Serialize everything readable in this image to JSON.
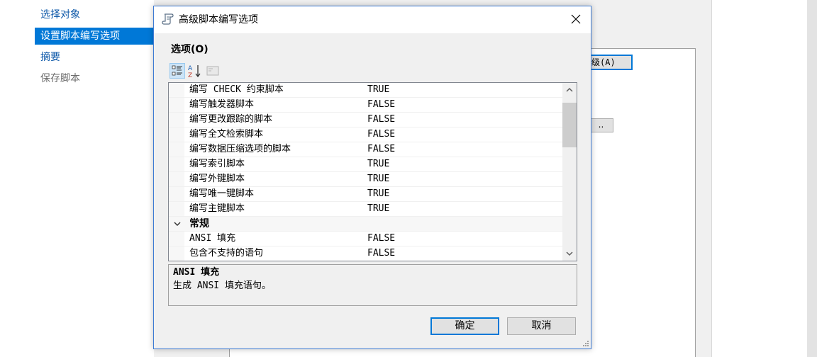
{
  "background": {
    "nav": [
      {
        "label": "选择对象",
        "state": "normal"
      },
      {
        "label": "设置脚本编写选项",
        "state": "active"
      },
      {
        "label": "摘要",
        "state": "normal"
      },
      {
        "label": "保存脚本",
        "state": "disabled"
      }
    ],
    "advanced_button_partial": "级(A)",
    "dots_button_partial": ".."
  },
  "dialog": {
    "title": "高级脚本编写选项",
    "section_label": "选项(O)",
    "toolbar": {
      "categorized_icon": "categorized-icon",
      "alphabetical_icon": "sort-az-icon",
      "property_pages_icon": "property-pages-icon"
    },
    "rows": [
      {
        "name": "编写 CHECK 约束脚本",
        "value": "TRUE"
      },
      {
        "name": "编写触发器脚本",
        "value": "FALSE"
      },
      {
        "name": "编写更改跟踪的脚本",
        "value": "FALSE"
      },
      {
        "name": "编写全文检索脚本",
        "value": "FALSE"
      },
      {
        "name": "编写数据压缩选项的脚本",
        "value": "FALSE"
      },
      {
        "name": "编写索引脚本",
        "value": "TRUE"
      },
      {
        "name": "编写外键脚本",
        "value": "TRUE"
      },
      {
        "name": "编写唯一键脚本",
        "value": "TRUE"
      },
      {
        "name": "编写主键脚本",
        "value": "TRUE"
      }
    ],
    "category": {
      "name": "常规"
    },
    "category_rows": [
      {
        "name": "ANSI 填充",
        "value": "FALSE"
      },
      {
        "name": "包含不支持的语句",
        "value": "FALSE"
      }
    ],
    "description": {
      "title": "ANSI 填充",
      "text": "生成 ANSI 填充语句。"
    },
    "ok_label": "确定",
    "cancel_label": "取消"
  },
  "colors": {
    "accent": "#0078d7",
    "nav_link": "#0b57a8",
    "dialog_bg": "#f0f0f0"
  }
}
